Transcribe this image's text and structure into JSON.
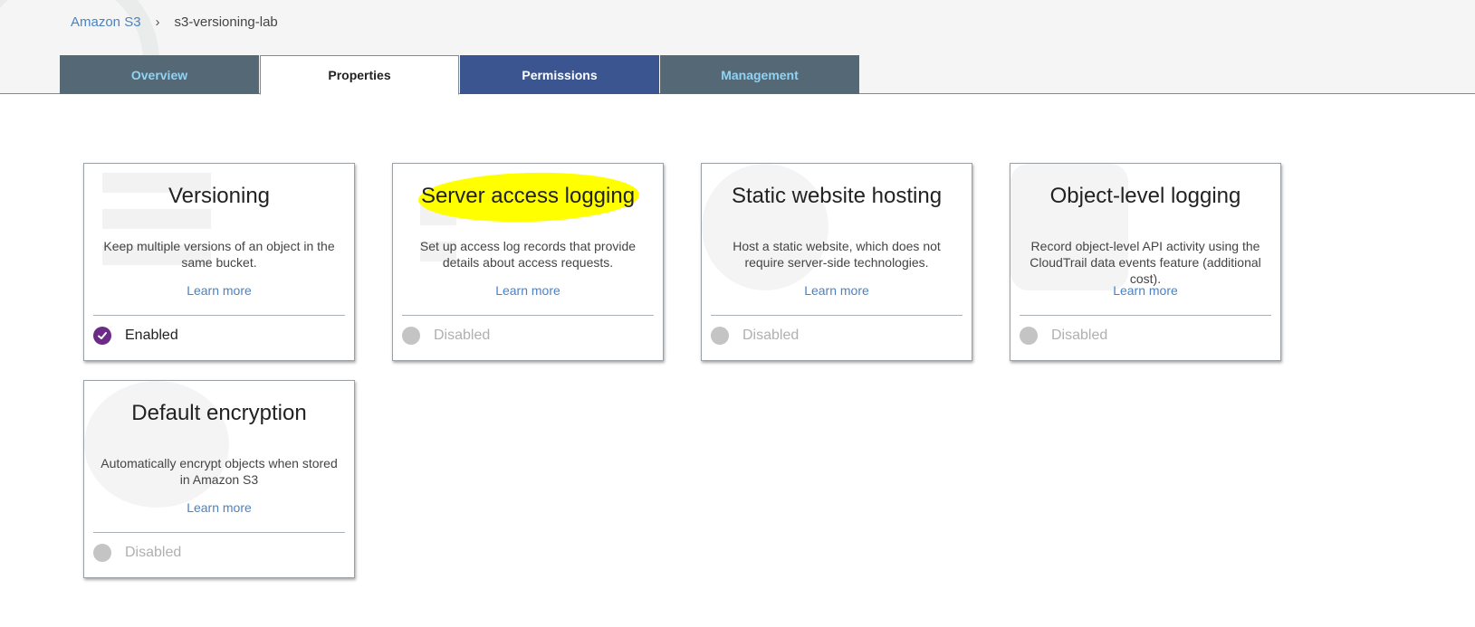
{
  "breadcrumb": {
    "root": "Amazon S3",
    "separator": "›",
    "current": "s3-versioning-lab"
  },
  "tabs": [
    {
      "label": "Overview"
    },
    {
      "label": "Properties"
    },
    {
      "label": "Permissions"
    },
    {
      "label": "Management"
    }
  ],
  "active_tab": "Properties",
  "cards": [
    {
      "title": "Versioning",
      "description": "Keep multiple versions of an object in the same bucket.",
      "learn_more": "Learn more",
      "status": "Enabled"
    },
    {
      "title": "Server access logging",
      "description": "Set up access log records that provide details about access requests.",
      "learn_more": "Learn more",
      "status": "Disabled"
    },
    {
      "title": "Static website hosting",
      "description": "Host a static website, which does not require server-side technologies.",
      "learn_more": "Learn more",
      "status": "Disabled"
    },
    {
      "title": "Object-level logging",
      "description": "Record object-level API activity using the CloudTrail data events feature (additional cost).",
      "learn_more": "Learn more",
      "status": "Disabled"
    },
    {
      "title": "Default encryption",
      "description": "Automatically encrypt objects when stored in Amazon S3",
      "learn_more": "Learn more",
      "status": "Disabled"
    }
  ],
  "colors": {
    "link": "#4a82c4",
    "tab_dark": "#546975",
    "tab_permissions": "#3a5590",
    "enabled_check": "#6c2b86",
    "highlight": "#ffff00"
  }
}
